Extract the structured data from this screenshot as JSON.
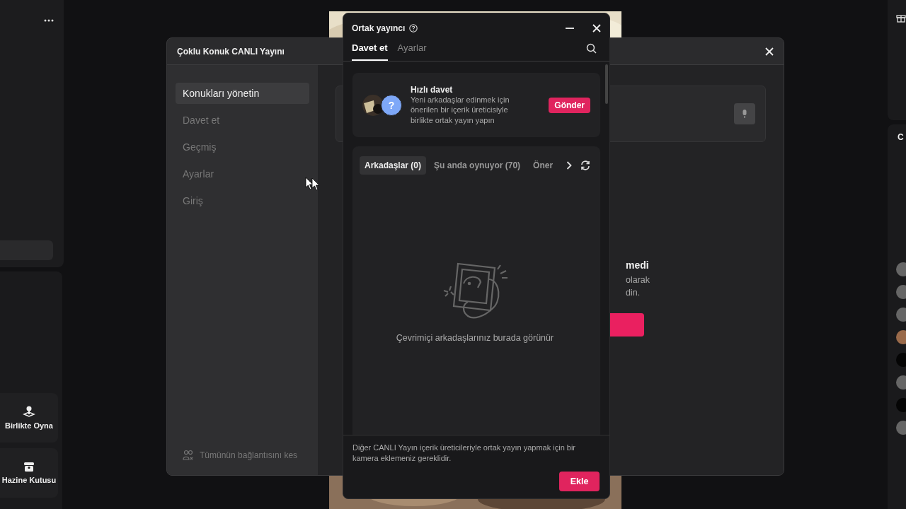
{
  "left_panel": {
    "buttons": [
      {
        "label": "Birlikte Oyna",
        "kind": "play"
      },
      {
        "label": "Hazine Kutusu",
        "kind": "chest"
      }
    ]
  },
  "right_panel": {
    "heading": "C"
  },
  "main_window": {
    "title": "Çoklu Konuk CANLI Yayını",
    "sidebar": {
      "items": [
        {
          "label": "Konukları yönetin",
          "selected": true
        },
        {
          "label": "Davet et",
          "selected": false
        },
        {
          "label": "Geçmiş",
          "selected": false
        },
        {
          "label": "Ayarlar",
          "selected": false
        },
        {
          "label": "Giriş",
          "selected": false
        }
      ],
      "footer": "Tümünün bağlantısını kes"
    },
    "content": {
      "heading": "medi",
      "lines": [
        "olarak",
        "din."
      ]
    }
  },
  "popup": {
    "title": "Ortak yayıncı",
    "tabs": [
      {
        "label": "Davet et",
        "selected": true
      },
      {
        "label": "Ayarlar",
        "selected": false
      }
    ],
    "quick_invite": {
      "title": "Hızlı davet",
      "description": "Yeni arkadaşlar edinmek için önerilen bir içerik üreticisiyle birlikte ortak yayın yapın",
      "avatar_glyph": "?",
      "button": "Gönder"
    },
    "filters": [
      {
        "label": "Arkadaşlar (0)",
        "selected": true
      },
      {
        "label": "Şu anda oynuyor (70)",
        "selected": false
      },
      {
        "label": "Öner",
        "selected": false
      }
    ],
    "empty_text": "Çevrimiçi arkadaşlarınız burada görünür",
    "footer_text": "Diğer CANLI Yayın içerik üreticileriyle ortak yayın yapmak için bir kamera eklemeniz gereklidir.",
    "footer_button": "Ekle"
  }
}
